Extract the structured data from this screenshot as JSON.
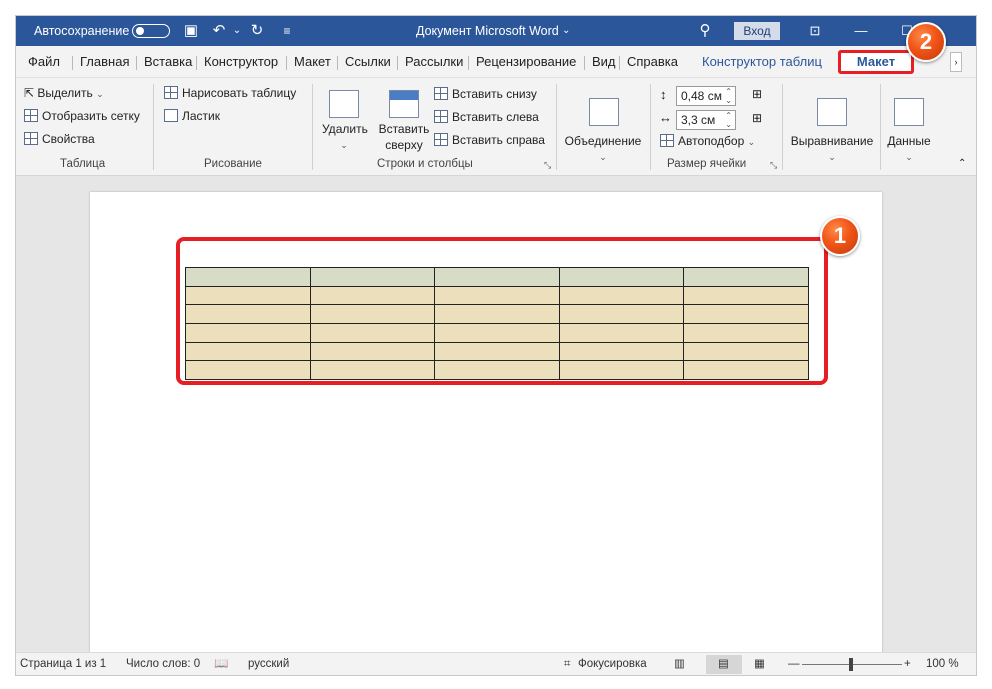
{
  "titlebar": {
    "autosave_label": "Автосохранение",
    "document_title": "Документ Microsoft Word",
    "title_caret": "⌄",
    "login_label": "Вход"
  },
  "menu": {
    "file": "Файл",
    "home": "Главная",
    "insert": "Вставка",
    "design": "Конструктор",
    "layout": "Макет",
    "references": "Ссылки",
    "mailings": "Рассылки",
    "review": "Рецензирование",
    "view": "Вид",
    "help": "Справка",
    "table_design": "Конструктор таблиц",
    "table_layout": "Макет",
    "overflow": "›"
  },
  "ribbon": {
    "table_group": {
      "select": "Выделить",
      "show_grid": "Отобразить сетку",
      "properties": "Свойства",
      "label": "Таблица"
    },
    "draw_group": {
      "draw_table": "Нарисовать таблицу",
      "eraser": "Ластик",
      "label": "Рисование"
    },
    "rows_cols_group": {
      "delete": "Удалить",
      "insert_above_1": "Вставить",
      "insert_above_2": "сверху",
      "insert_below": "Вставить снизу",
      "insert_left": "Вставить слева",
      "insert_right": "Вставить справа",
      "label": "Строки и столбцы"
    },
    "merge_group": {
      "merge": "Объединение"
    },
    "cell_size_group": {
      "height_value": "0,48 см",
      "width_value": "3,3 см",
      "autofit": "Автоподбор",
      "label": "Размер ячейки"
    },
    "align_group": {
      "alignment": "Выравнивание"
    },
    "data_group": {
      "data": "Данные"
    }
  },
  "table": {
    "rows": 6,
    "cols": 5,
    "header_color": "#d6dcc5",
    "body_color": "#ecdfbb"
  },
  "annotations": {
    "badge1": "1",
    "badge2": "2",
    "highlight_color": "#e81e25"
  },
  "statusbar": {
    "page": "Страница 1 из 1",
    "words": "Число слов: 0",
    "language": "русский",
    "focus": "Фокусировка",
    "zoom": "100 %"
  }
}
